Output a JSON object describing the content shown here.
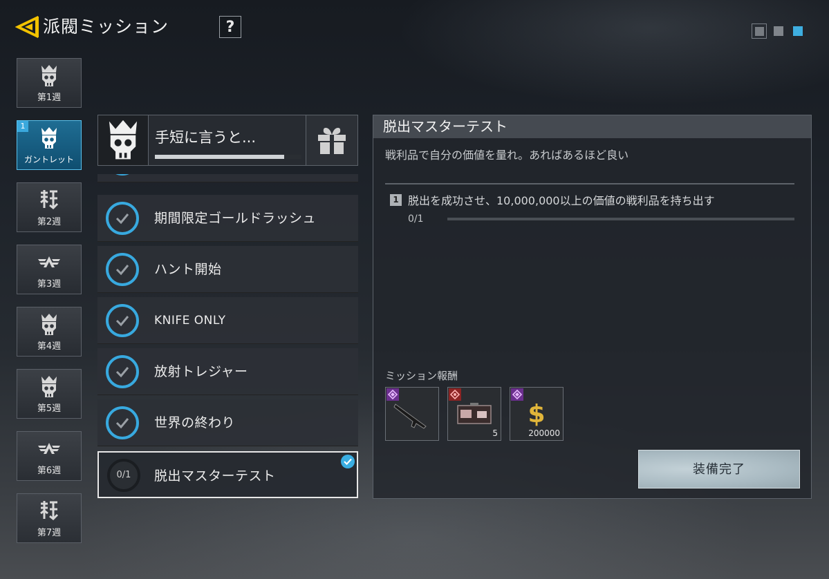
{
  "header": {
    "title": "派閥ミッション",
    "help_label": "?",
    "back_icon": "back-arrow-icon"
  },
  "weeks": [
    {
      "label": "第1週",
      "icon": "skull-crown-icon",
      "active": false
    },
    {
      "label": "ガントレット",
      "icon": "skull-crown-icon",
      "active": true,
      "badge": "1"
    },
    {
      "label": "第2週",
      "icon": "kanji-emblem-icon",
      "active": false
    },
    {
      "label": "第3週",
      "icon": "wings-emblem-icon",
      "active": false
    },
    {
      "label": "第4週",
      "icon": "skull-crown-icon",
      "active": false
    },
    {
      "label": "第5週",
      "icon": "skull-crown-icon",
      "active": false
    },
    {
      "label": "第6週",
      "icon": "wings-emblem-icon",
      "active": false
    },
    {
      "label": "第7週",
      "icon": "kanji-emblem-icon",
      "active": false
    }
  ],
  "faction": {
    "name": "手短に言うと...",
    "progress": 0.88,
    "gift_icon": "gift-icon"
  },
  "missions": [
    {
      "name": "期間限定ゴールドラッシュ",
      "completed": true
    },
    {
      "name": "ハント開始",
      "completed": true
    },
    {
      "name": "KNIFE ONLY",
      "completed": true
    },
    {
      "name": "放射トレジャー",
      "completed": true
    },
    {
      "name": "世界の終わり",
      "completed": true
    },
    {
      "name": "脱出マスターテスト",
      "completed": false,
      "progress": "0/1",
      "selected": true
    }
  ],
  "detail": {
    "title": "脱出マスターテスト",
    "description": "戦利品で自分の価値を量れ。あればあるほど良い",
    "objective_number": "1",
    "objective_text": "脱出を成功させ、10,000,000以上の価値の戦利品を持ち出す",
    "objective_count": "0/1",
    "objective_progress": 0,
    "reward_label": "ミッション報酬",
    "rewards": [
      {
        "item": "rifle",
        "rarity": "purple",
        "quantity": ""
      },
      {
        "item": "case",
        "rarity": "red",
        "quantity": "5"
      },
      {
        "item": "cash",
        "rarity": "purple",
        "quantity": "200000"
      }
    ],
    "equip_button": "装備完了"
  },
  "colors": {
    "accent": "#3aaee2",
    "back_arrow": "#f2c200",
    "rarity_purple": "#6b2f8e",
    "rarity_red": "#8c2424"
  }
}
